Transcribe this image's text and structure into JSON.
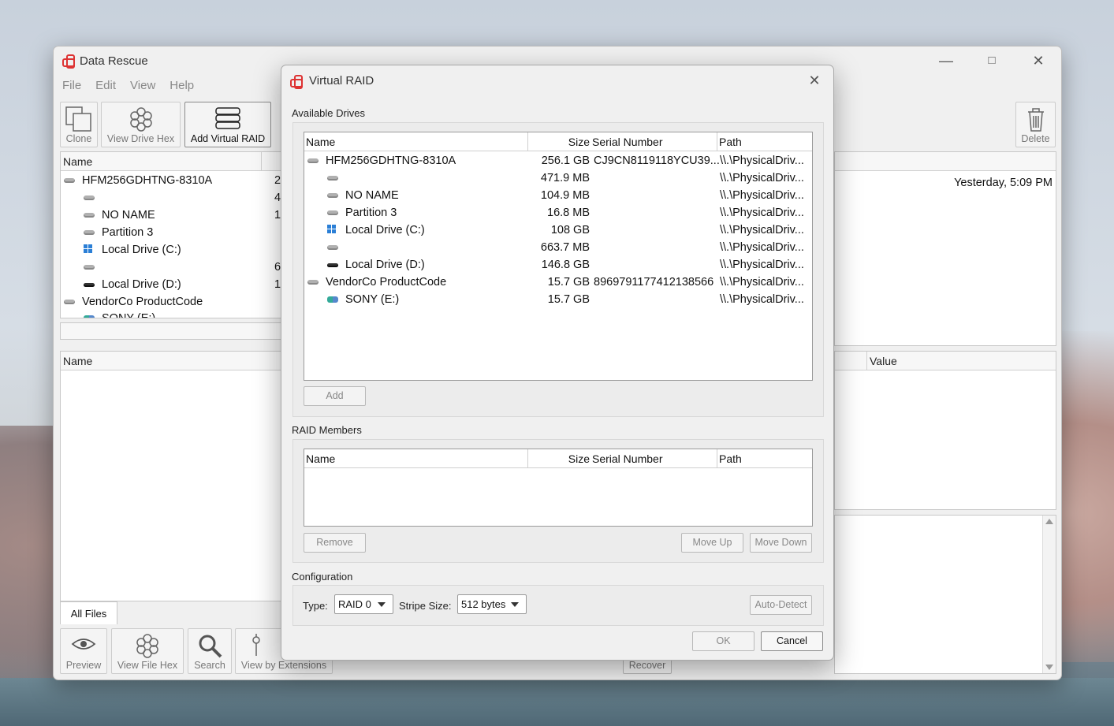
{
  "main": {
    "title": "Data Rescue",
    "menu": [
      "File",
      "Edit",
      "View",
      "Help"
    ],
    "toolbar": {
      "clone": "Clone",
      "view_drive_hex": "View Drive Hex",
      "add_virtual_raid": "Add Virtual RAID",
      "delete": "Delete"
    },
    "drives_header": {
      "name": "Name"
    },
    "drives": [
      {
        "name": "HFM256GDHTNG-8310A",
        "size": "2"
      },
      {
        "name": "",
        "size": "4"
      },
      {
        "name": "NO NAME",
        "size": "1"
      },
      {
        "name": "Partition 3",
        "size": ""
      },
      {
        "name": "Local Drive (C:)",
        "size": ""
      },
      {
        "name": "",
        "size": "6"
      },
      {
        "name": "Local Drive (D:)",
        "size": "1"
      },
      {
        "name": "VendorCo ProductCode",
        "size": ""
      },
      {
        "name": "SONY (E:)",
        "size": ""
      }
    ],
    "date_text": "Yesterday, 5:09 PM",
    "props_header": {
      "name": "Name",
      "value": "Value"
    },
    "tab_all_files": "All Files",
    "bottom_toolbar": {
      "preview": "Preview",
      "view_file_hex": "View File Hex",
      "search": "Search",
      "view_by_extensions": "View by Extensions",
      "recover": "Recover"
    }
  },
  "dialog": {
    "title": "Virtual RAID",
    "available_label": "Available Drives",
    "columns": {
      "name": "Name",
      "size": "Size",
      "serial": "Serial Number",
      "path": "Path"
    },
    "drives": [
      {
        "name": "HFM256GDHTNG-8310A",
        "size": "256.1 GB",
        "serial": "CJ9CN8119118YCU39...",
        "path": "\\\\.\\PhysicalDriv...",
        "icon": "disk"
      },
      {
        "name": "",
        "size": "471.9 MB",
        "serial": "",
        "path": "\\\\.\\PhysicalDriv...",
        "icon": "disk"
      },
      {
        "name": "NO NAME",
        "size": "104.9 MB",
        "serial": "",
        "path": "\\\\.\\PhysicalDriv...",
        "icon": "disk"
      },
      {
        "name": "Partition 3",
        "size": "16.8 MB",
        "serial": "",
        "path": "\\\\.\\PhysicalDriv...",
        "icon": "disk"
      },
      {
        "name": "Local Drive (C:)",
        "size": "108 GB",
        "serial": "",
        "path": "\\\\.\\PhysicalDriv...",
        "icon": "windows"
      },
      {
        "name": "",
        "size": "663.7 MB",
        "serial": "",
        "path": "\\\\.\\PhysicalDriv...",
        "icon": "disk"
      },
      {
        "name": "Local Drive (D:)",
        "size": "146.8 GB",
        "serial": "",
        "path": "\\\\.\\PhysicalDriv...",
        "icon": "dark-disk"
      },
      {
        "name": "VendorCo ProductCode",
        "size": "15.7 GB",
        "serial": "8969791177412138566",
        "path": "\\\\.\\PhysicalDriv...",
        "icon": "disk"
      },
      {
        "name": "SONY (E:)",
        "size": "15.7 GB",
        "serial": "",
        "path": "\\\\.\\PhysicalDriv...",
        "icon": "usb"
      }
    ],
    "add_label": "Add",
    "members_label": "RAID Members",
    "remove_label": "Remove",
    "move_up_label": "Move Up",
    "move_down_label": "Move Down",
    "config_label": "Configuration",
    "type_label": "Type:",
    "type_value": "RAID 0",
    "stripe_label": "Stripe Size:",
    "stripe_value": "512 bytes",
    "auto_detect_label": "Auto-Detect",
    "ok_label": "OK",
    "cancel_label": "Cancel"
  }
}
